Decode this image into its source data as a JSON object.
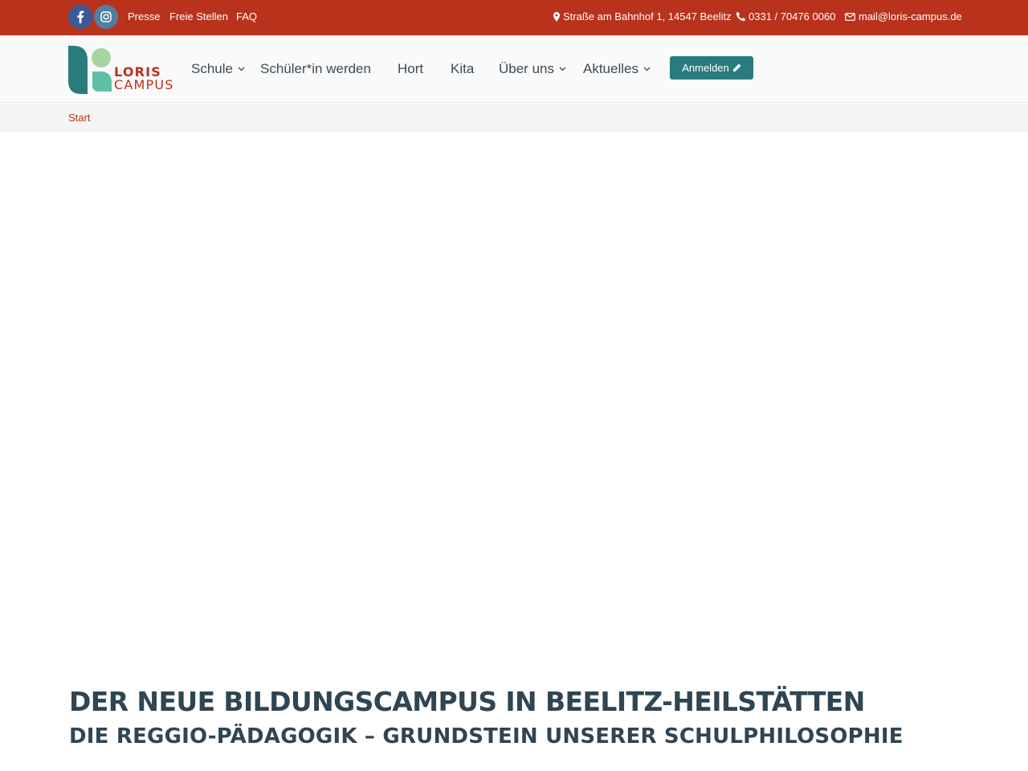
{
  "topbar": {
    "social": [
      {
        "name": "facebook",
        "icon": "facebook-icon"
      },
      {
        "name": "instagram",
        "icon": "instagram-icon"
      }
    ],
    "links": {
      "presse": "Presse",
      "stellen": "Freie Stellen",
      "faq": "FAQ"
    },
    "contact": {
      "address": "Straße am Bahnhof 1, 14547 Beelitz",
      "phone": "0331 / 70476 0060",
      "email": "mail@loris-campus.de"
    }
  },
  "logo": {
    "line1": "LORIS",
    "line2": "CAMPUS"
  },
  "nav": {
    "schule": "Schule",
    "schueler": "Schüler*in werden",
    "hort": "Hort",
    "kita": "Kita",
    "ueber": "Über uns",
    "aktuelles": "Aktuelles",
    "anmelden": "Anmelden"
  },
  "breadcrumb": {
    "start": "Start"
  },
  "content": {
    "title": "DER NEUE BILDUNGSCAMPUS IN BEELITZ-HEILSTÄTTEN",
    "subtitle": "DIE REGGIO-PÄDAGOGIK – GRUNDSTEIN UNSERER SCHULPHILOSOPHIE"
  },
  "colors": {
    "brand_red": "#b9321b",
    "brand_teal": "#2a7b7e",
    "heading": "#2f4553"
  }
}
